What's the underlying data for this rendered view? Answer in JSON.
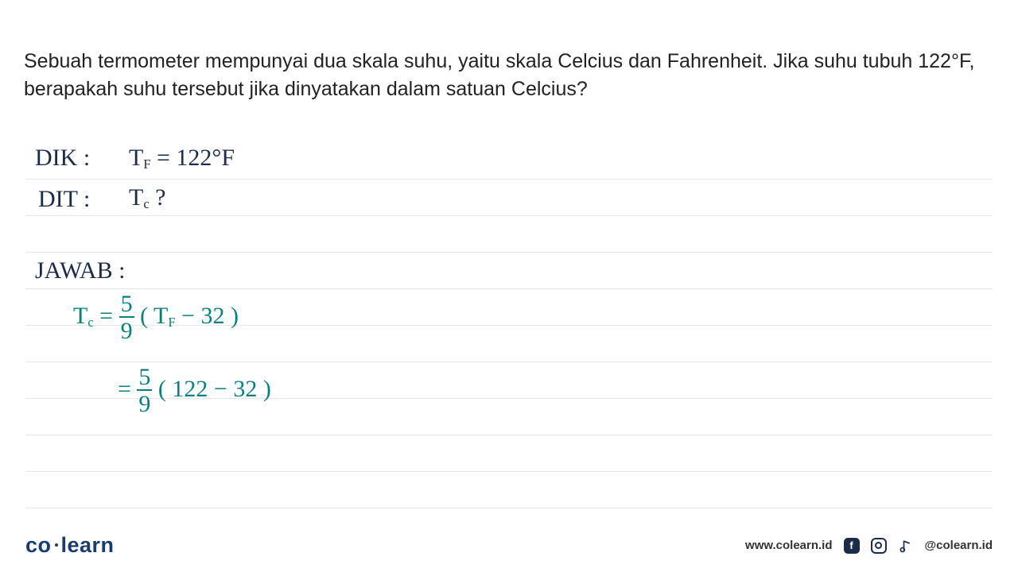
{
  "question": "Sebuah termometer mempunyai dua skala suhu, yaitu skala Celcius dan Fahrenheit. Jika suhu tubuh 122°F, berapakah suhu tersebut jika dinyatakan dalam satuan Celcius?",
  "work": {
    "dik_label": "DIK :",
    "dik_value_pre": "T",
    "dik_sub": "F",
    "dik_value_post": " = 122°F",
    "dit_label": "DIT :",
    "dit_value_pre": "T",
    "dit_sub": "c",
    "dit_value_post": " ?",
    "jawab_label": "JAWAB :",
    "eq1": {
      "lhs_pre": "T",
      "lhs_sub": "c",
      "lhs_eq": " = ",
      "frac_num": "5",
      "frac_den": "9",
      "paren_pre": "( T",
      "paren_sub": "F",
      "paren_post": " − 32 )"
    },
    "eq2": {
      "lhs": "= ",
      "frac_num": "5",
      "frac_den": "9",
      "paren": "( 122 − 32 )"
    }
  },
  "footer": {
    "brand_a": "co",
    "brand_b": "learn",
    "url": "www.colearn.id",
    "handle": "@colearn.id",
    "fb": "f"
  }
}
